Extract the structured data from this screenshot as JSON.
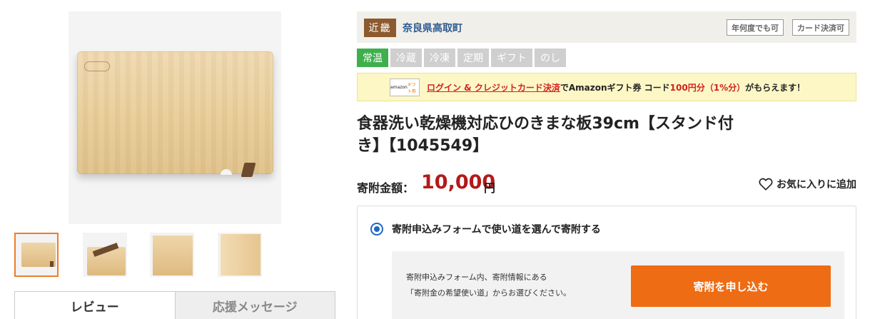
{
  "tabs": {
    "review_label": "レビュー",
    "support_label": "応援メッセージ"
  },
  "region": {
    "badge": "近畿",
    "name": "奈良県高取町",
    "pills": [
      "年何度でも可",
      "カード決済可"
    ]
  },
  "temperature_tags": [
    {
      "label": "常温",
      "active": true
    },
    {
      "label": "冷蔵",
      "active": false
    },
    {
      "label": "冷凍",
      "active": false
    },
    {
      "label": "定期",
      "active": false
    },
    {
      "label": "ギフト",
      "active": false
    },
    {
      "label": "のし",
      "active": false
    }
  ],
  "amazon_banner": {
    "logo_text": "amazon",
    "logo_gift": "ギフト券",
    "link_text": "ログイン & クレジットカード決済",
    "mid_text": "でAmazonギフト券 コード",
    "amount_text": "100円分（1%分）",
    "end_text": "がもらえます！"
  },
  "product": {
    "title": "食器洗い乾燥機対応ひのきまな板39cm【スタンド付き】【1045549】"
  },
  "price": {
    "label": "寄附金額：",
    "value": "10,000",
    "unit": "円",
    "favorite_label": "お気に入りに追加"
  },
  "donate": {
    "option_label": "寄附申込みフォームで使い道を選んで寄附する",
    "note_line1": "寄附申込みフォーム内、寄附情報にある",
    "note_line2": "「寄附金の希望使い道」からお選びください。",
    "button_label": "寄附を申し込む"
  },
  "colors": {
    "accent_orange": "#ee6c14",
    "price_red": "#b21a1a",
    "active_green": "#3faf4d",
    "region_brown": "#8c5a2e",
    "link_blue": "#2d5c91"
  }
}
